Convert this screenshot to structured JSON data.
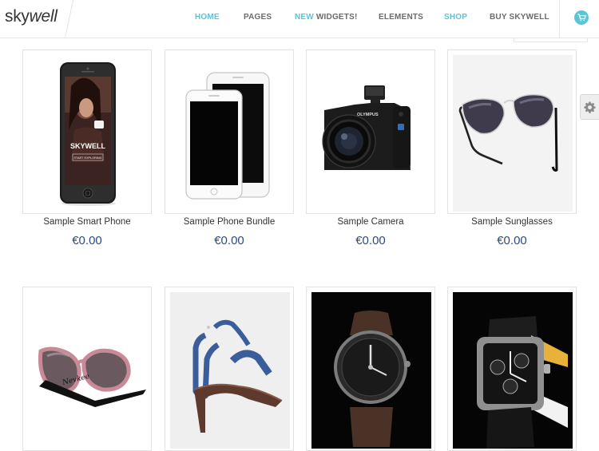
{
  "logo": {
    "part1": "sky",
    "part2": "well"
  },
  "nav": {
    "home": "HOME",
    "pages": "PAGES",
    "new_prefix": "NEW",
    "widgets": " WIDGETS!",
    "elements": "ELEMENTS",
    "shop": "SHOP",
    "buy": "BUY SKYWELL"
  },
  "cart_icon": "shopping-cart-icon",
  "settings_icon": "gear-icon",
  "accent_color": "#5bc4d6",
  "price_color": "#2b4c7e",
  "products": [
    {
      "name": "Sample Smart Phone",
      "price": "€0.00",
      "screen_brand": "SKYWELL",
      "screen_cta": "START EXPLORING"
    },
    {
      "name": "Sample Phone Bundle",
      "price": "€0.00"
    },
    {
      "name": "Sample Camera",
      "price": "€0.00",
      "brand": "OLYMPUS"
    },
    {
      "name": "Sample Sunglasses",
      "price": "€0.00"
    },
    {
      "name": "",
      "price": "",
      "brand": "Nevkee"
    },
    {
      "name": "",
      "price": ""
    },
    {
      "name": "",
      "price": ""
    },
    {
      "name": "",
      "price": ""
    }
  ]
}
